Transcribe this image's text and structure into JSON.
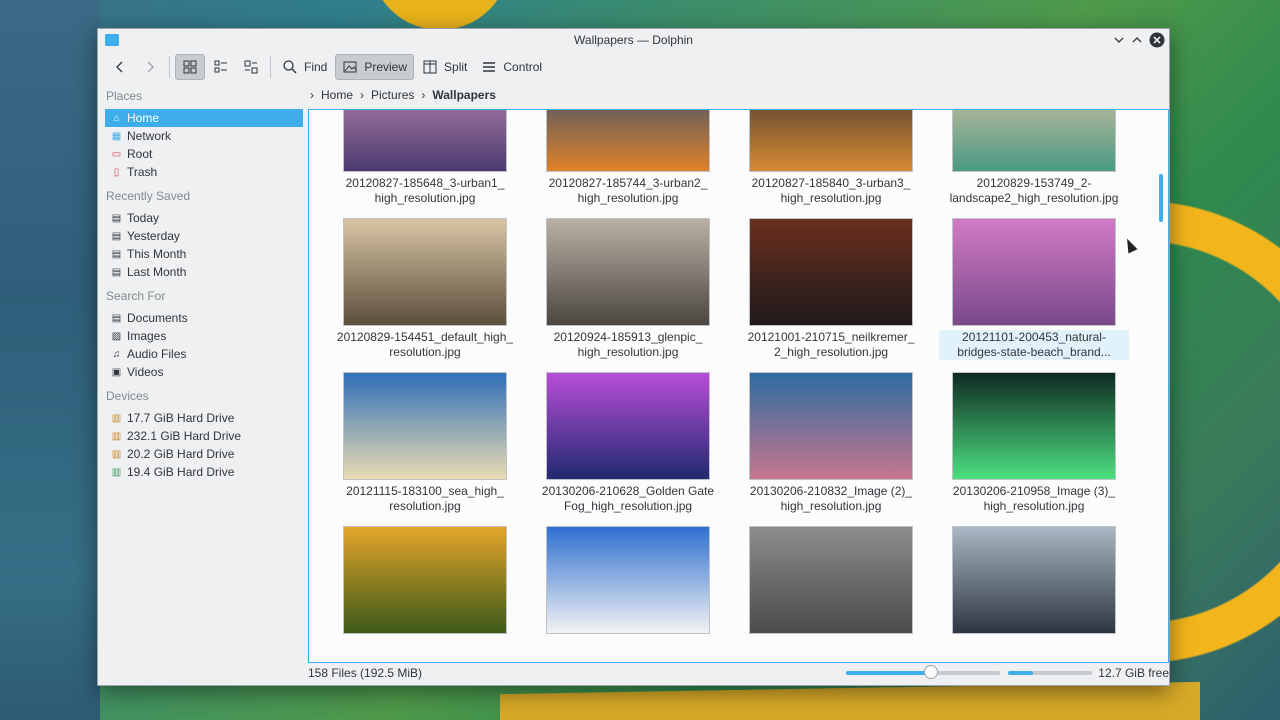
{
  "window": {
    "title": "Wallpapers — Dolphin"
  },
  "toolbar": {
    "find": "Find",
    "preview": "Preview",
    "split": "Split",
    "control": "Control"
  },
  "sidebar": {
    "places_header": "Places",
    "places": [
      {
        "label": "Home",
        "icon": "home-icon"
      },
      {
        "label": "Network",
        "icon": "network-icon"
      },
      {
        "label": "Root",
        "icon": "folder-icon"
      },
      {
        "label": "Trash",
        "icon": "trash-icon"
      }
    ],
    "recent_header": "Recently Saved",
    "recent": [
      {
        "label": "Today"
      },
      {
        "label": "Yesterday"
      },
      {
        "label": "This Month"
      },
      {
        "label": "Last Month"
      }
    ],
    "search_header": "Search For",
    "search": [
      {
        "label": "Documents",
        "icon": "document-icon"
      },
      {
        "label": "Images",
        "icon": "image-icon"
      },
      {
        "label": "Audio Files",
        "icon": "music-icon"
      },
      {
        "label": "Videos",
        "icon": "video-icon"
      }
    ],
    "devices_header": "Devices",
    "devices": [
      {
        "label": "17.7 GiB Hard Drive"
      },
      {
        "label": "232.1 GiB Hard Drive"
      },
      {
        "label": "20.2 GiB Hard Drive"
      },
      {
        "label": "19.4 GiB Hard Drive"
      }
    ]
  },
  "breadcrumb": {
    "items": [
      "Home",
      "Pictures"
    ],
    "current": "Wallpapers"
  },
  "files": [
    {
      "name": "20120827-185648_3-urban1_\nhigh_resolution.jpg",
      "colors": [
        "#c58fb4",
        "#4a3a70"
      ]
    },
    {
      "name": "20120827-185744_3-urban2_\nhigh_resolution.jpg",
      "colors": [
        "#1f4a78",
        "#e0812a"
      ]
    },
    {
      "name": "20120827-185840_3-urban3_\nhigh_resolution.jpg",
      "colors": [
        "#2b2b2f",
        "#d88a33"
      ]
    },
    {
      "name": "20120829-153749_2-\nlandscape2_high_resolution.jpg",
      "colors": [
        "#e9c7a5",
        "#4a9a84"
      ]
    },
    {
      "name": "20120829-154451_default_high_\nresolution.jpg",
      "colors": [
        "#d9c5a4",
        "#5b4e3c"
      ]
    },
    {
      "name": "20120924-185913_glenpic_\nhigh_resolution.jpg",
      "colors": [
        "#b9b1a4",
        "#4b4640"
      ]
    },
    {
      "name": "20121001-210715_neilkremer_\n2_high_resolution.jpg",
      "colors": [
        "#6a2f1f",
        "#1f1a1a"
      ]
    },
    {
      "name": "20121101-200453_natural-\nbridges-state-beach_brand...",
      "colors": [
        "#d27ac6",
        "#7a4a8a"
      ],
      "highlight": true
    },
    {
      "name": "20121115-183100_sea_high_\nresolution.jpg",
      "colors": [
        "#2f6fb8",
        "#e9dcb2"
      ]
    },
    {
      "name": "20130206-210628_Golden Gate\nFog_high_resolution.jpg",
      "colors": [
        "#b84ed8",
        "#202a70"
      ]
    },
    {
      "name": "20130206-210832_Image (2)_\nhigh_resolution.jpg",
      "colors": [
        "#2d6ca1",
        "#c8768e"
      ]
    },
    {
      "name": "20130206-210958_Image (3)_\nhigh_resolution.jpg",
      "colors": [
        "#0f2a22",
        "#4ce080"
      ]
    },
    {
      "name": "",
      "colors": [
        "#e3a52a",
        "#3d5a1a"
      ]
    },
    {
      "name": "",
      "colors": [
        "#2f6fd0",
        "#f3f3f3"
      ]
    },
    {
      "name": "",
      "colors": [
        "#8b8c8c",
        "#4a4c4e"
      ]
    },
    {
      "name": "",
      "colors": [
        "#aab7c4",
        "#2c3640"
      ]
    }
  ],
  "status": {
    "count": "158 Files (192.5 MiB)",
    "free": "12.7 GiB free",
    "zoom_fraction": 0.55,
    "space_used_fraction": 0.3
  },
  "colors": {
    "accent": "#3daee9"
  }
}
